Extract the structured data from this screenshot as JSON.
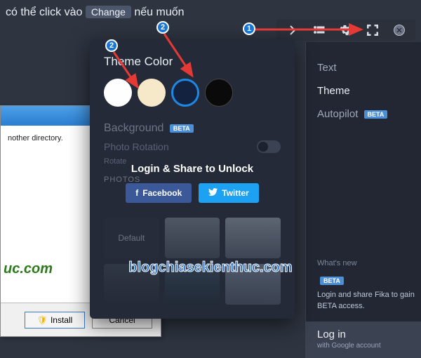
{
  "top_instruction": {
    "before": "có thể click vào",
    "kbd": "Change",
    "after": "nếu muốn"
  },
  "toolbar": {
    "chevron": "›",
    "list_icon": "list-icon",
    "gear_icon": "gear-icon",
    "fullscreen_icon": "fullscreen-icon",
    "close_icon": "close-icon"
  },
  "sidebar": {
    "items": [
      {
        "label": "Text"
      },
      {
        "label": "Theme"
      },
      {
        "label": "Autopilot",
        "beta": "BETA"
      }
    ],
    "whats_new": "What's new",
    "beta_badge": "BETA",
    "beta_desc": "Login and share Fika to gain BETA access.",
    "login": "Log in",
    "login_sub": "with Google account"
  },
  "settings": {
    "theme_title": "Theme Color",
    "swatches": [
      "white",
      "cream",
      "darkblue",
      "black"
    ],
    "background_title": "Background",
    "background_badge": "BETA",
    "photo_rotation": "Photo Rotation",
    "photo_sub": "Rotate",
    "unlock_title": "Login & Share to Unlock",
    "facebook": "Facebook",
    "twitter": "Twitter",
    "photos_heading": "PHOTOS",
    "default_thumb": "Default"
  },
  "installer": {
    "dir_text": "nother directory.",
    "brand": "uc.com",
    "install": "Install",
    "cancel": "Cancel"
  },
  "annotations": {
    "label1": "1",
    "label2": "2"
  },
  "watermark": "blogchiasekienthuc.com"
}
